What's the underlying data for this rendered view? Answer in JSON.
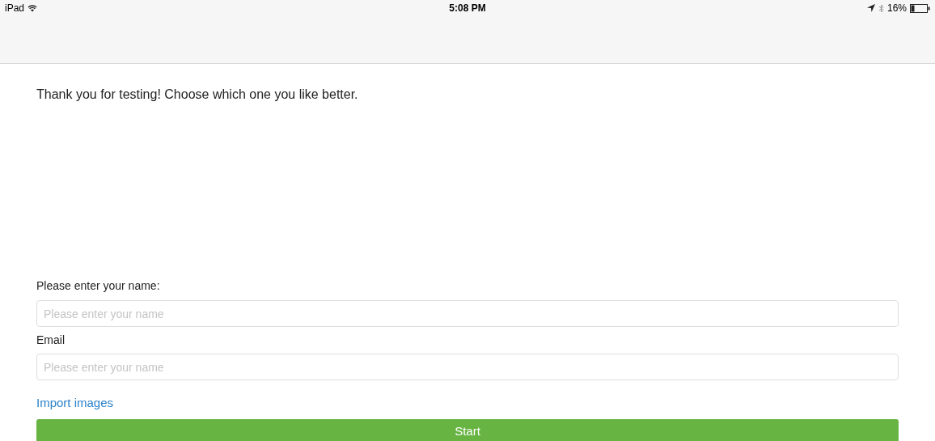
{
  "status_bar": {
    "device": "iPad",
    "time": "5:08 PM",
    "battery": "16%"
  },
  "message": "Thank you for testing! Choose which one you like better.",
  "fields": [
    {
      "label": "Please enter your name:",
      "placeholder": "Please enter your name"
    },
    {
      "label": "Email",
      "placeholder": "Please enter your name"
    }
  ],
  "import_link": "Import images",
  "start_button": "Start"
}
